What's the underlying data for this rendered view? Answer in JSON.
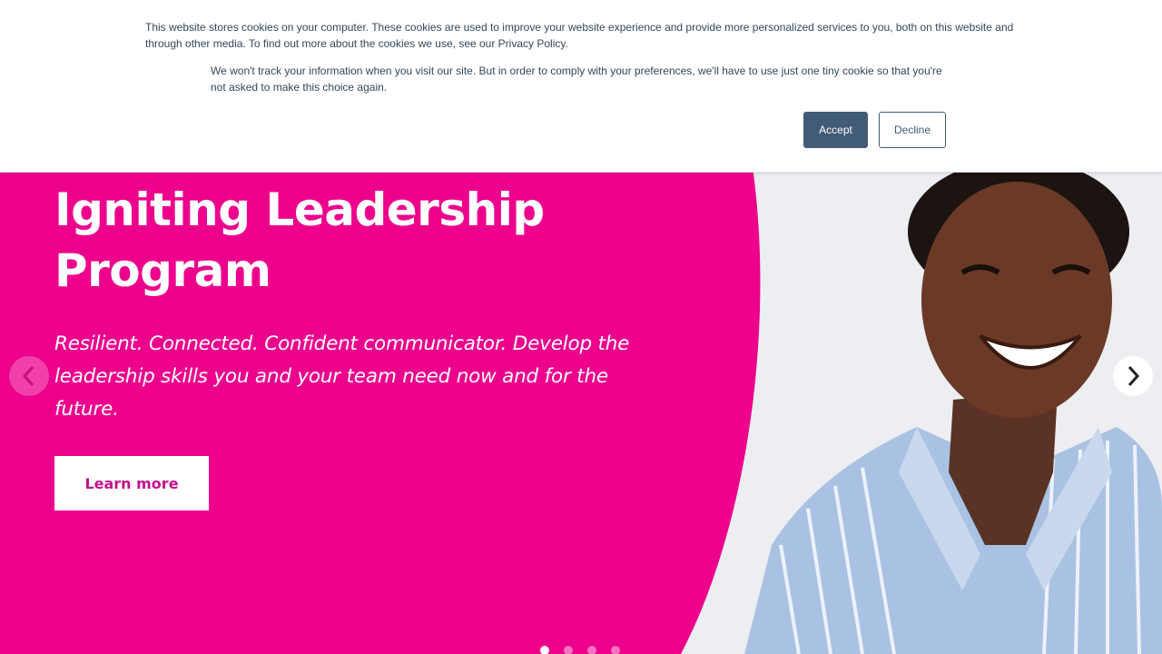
{
  "cookie_banner": {
    "message": "This website stores cookies on your computer. These cookies are used to improve your website experience and provide more personalized services to you, both on this website and through other media. To find out more about the cookies we use, see our Privacy Policy.",
    "preference_note": "We won't track your information when you visit our site. But in order to comply with your preferences, we'll have to use just one tiny cookie so that you're not asked to make this choice again.",
    "accept_label": "Accept",
    "decline_label": "Decline"
  },
  "hero": {
    "title": "Igniting Leadership Program",
    "subtitle": "Resilient. Connected. Confident communicator. Develop the leadership skills you and your team need now and for the future.",
    "cta_label": "Learn more",
    "prev_icon": "chevron-left-icon",
    "next_icon": "chevron-right-icon",
    "slide_count": 4,
    "active_slide": 1
  },
  "colors": {
    "brand_pink": "#ec008c",
    "cta_text": "#c3118c",
    "cookie_accept_bg": "#425b76",
    "cookie_text": "#33475b"
  }
}
